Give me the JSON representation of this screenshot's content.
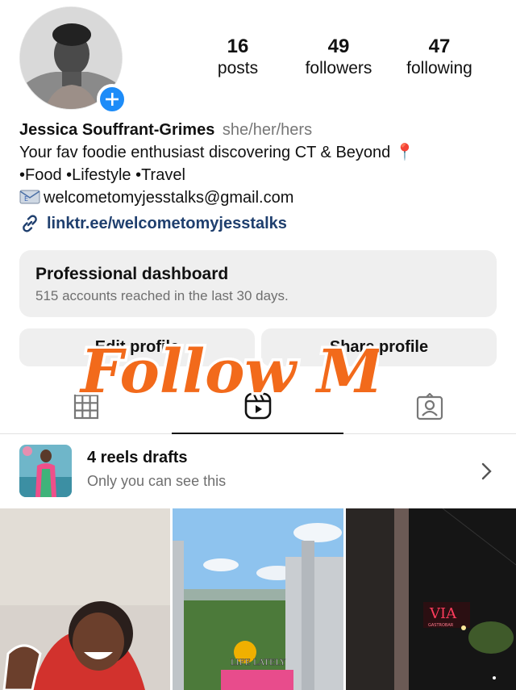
{
  "profile": {
    "stats": [
      {
        "number": "16",
        "label": "posts"
      },
      {
        "number": "49",
        "label": "followers"
      },
      {
        "number": "47",
        "label": "following"
      }
    ],
    "name": "Jessica Souffrant-Grimes",
    "pronouns": "she/her/hers",
    "bio_line1": "Your fav foodie enthusiast discovering CT & Beyond 📍",
    "bio_line2": "•Food •Lifestyle •Travel",
    "email": "welcometomyjesstalks@gmail.com",
    "link": "linktr.ee/welcometomyjesstalks"
  },
  "dashboard": {
    "title": "Professional dashboard",
    "subtitle": "515 accounts reached in the last 30 days."
  },
  "buttons": {
    "edit_profile": "Edit profile",
    "share_profile": "Share profile"
  },
  "overlay": {
    "text": "Follow Me",
    "color": "#f26a1b"
  },
  "tabs": {
    "items": [
      "grid-icon",
      "reels-icon",
      "tagged-icon"
    ],
    "active": "reels-icon"
  },
  "drafts": {
    "title": "4 reels drafts",
    "subtitle": "Only you can see this"
  },
  "reels": {
    "cell3_sign": "VIA",
    "cell3_sign_sub": "GASTROBAR",
    "cell2_caption": "LIFE LATELY"
  },
  "colors": {
    "accent_blue": "#1d8cf8",
    "link_color": "#1f3f6e",
    "button_gray": "#efefef"
  }
}
